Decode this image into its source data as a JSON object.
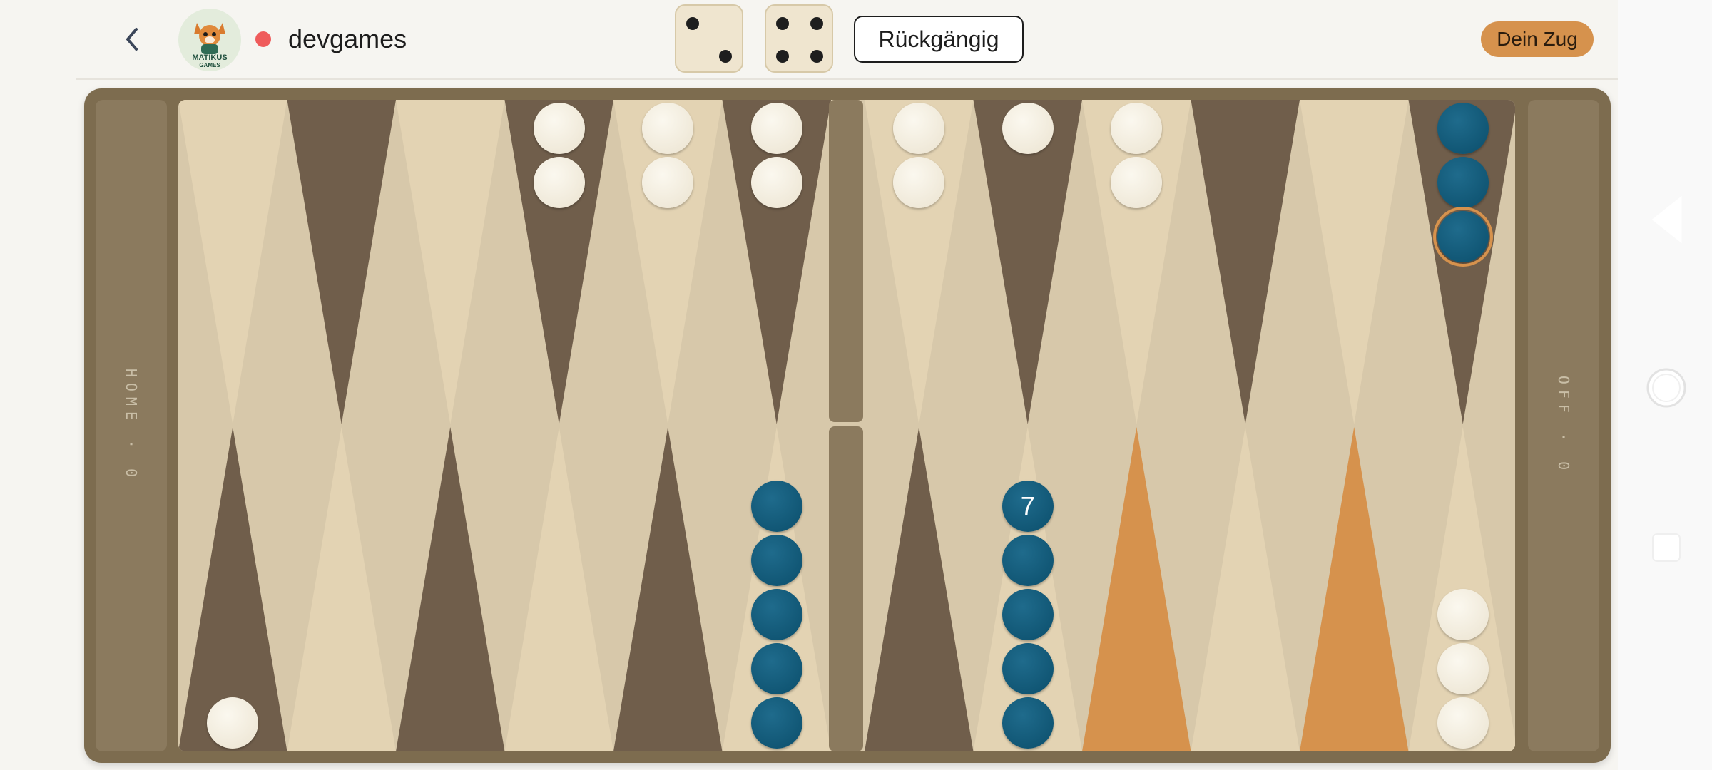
{
  "header": {
    "back_icon": "chevron-left-icon",
    "logo_text_line1": "MATIKUS",
    "logo_text_line2": "GAMES",
    "status_color": "#ef5b5b",
    "opponent_name": "devgames",
    "dice": [
      2,
      4
    ],
    "undo_label": "Rückgängig",
    "turn_label": "Dein Zug",
    "accent": "#d6924d"
  },
  "board": {
    "home_label": "HOME · 0",
    "off_label": "OFF · 0",
    "stack_count_label": "7",
    "colors": {
      "dark_point": "#705e4b",
      "light_point": "#e3d3b3",
      "highlight_point": "#d6924d",
      "player_checker": "#0e5677",
      "opponent_checker": "#f1ebdc"
    },
    "top_row": [
      {
        "count": 0,
        "color": ""
      },
      {
        "count": 0,
        "color": ""
      },
      {
        "count": 0,
        "color": ""
      },
      {
        "count": 2,
        "color": "white"
      },
      {
        "count": 2,
        "color": "white"
      },
      {
        "count": 2,
        "color": "white"
      },
      {
        "count": 2,
        "color": "white"
      },
      {
        "count": 1,
        "color": "white"
      },
      {
        "count": 2,
        "color": "white"
      },
      {
        "count": 0,
        "color": ""
      },
      {
        "count": 0,
        "color": ""
      },
      {
        "count": 3,
        "color": "blue",
        "selected_top": true
      }
    ],
    "bottom_row": [
      {
        "count": 1,
        "color": "white"
      },
      {
        "count": 0,
        "color": ""
      },
      {
        "count": 0,
        "color": ""
      },
      {
        "count": 0,
        "color": ""
      },
      {
        "count": 0,
        "color": ""
      },
      {
        "count": 5,
        "color": "blue"
      },
      {
        "count": 0,
        "color": ""
      },
      {
        "count": 7,
        "color": "blue",
        "shown": 5
      },
      {
        "count": 0,
        "color": "",
        "highlight": true
      },
      {
        "count": 0,
        "color": ""
      },
      {
        "count": 0,
        "color": "",
        "highlight": true
      },
      {
        "count": 3,
        "color": "white"
      }
    ]
  },
  "side_nav": {
    "icons": [
      "back-triangle-icon",
      "home-circle-icon",
      "recents-square-icon"
    ]
  }
}
